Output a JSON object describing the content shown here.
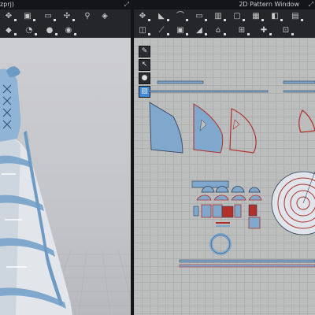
{
  "left_window": {
    "title": "zprj)"
  },
  "right_window": {
    "title": "2D Pattern Window"
  },
  "colors": {
    "accent": "#3d8ad6",
    "fabric": "#7fa8cc",
    "seam": "#b0302c",
    "grid": "#aeb0b0"
  },
  "left_toolbar_row1": [
    "move-icon",
    "transform-icon",
    "lasso-icon",
    "select-icon",
    "pin-icon",
    "tack-icon"
  ],
  "left_toolbar_row2": [
    "pattern-icon",
    "arrange-icon",
    "simulate-icon",
    "avatar-icon"
  ],
  "right_toolbar_row1": [
    "transform-pattern-icon",
    "edit-point-icon",
    "curve-icon",
    "rect-icon",
    "polygon-icon",
    "circle-icon",
    "internal-shape-icon",
    "dart-icon",
    "text-icon"
  ],
  "right_toolbar_row2": [
    "segment-sewing-icon",
    "free-sewing-icon",
    "check-sewing-icon",
    "tack-icon",
    "fold-icon",
    "trim-icon",
    "zip-icon",
    "grain-icon"
  ],
  "side_tools": [
    "pencil-icon",
    "cursor-icon",
    "sphere-icon",
    "texture-icon"
  ]
}
